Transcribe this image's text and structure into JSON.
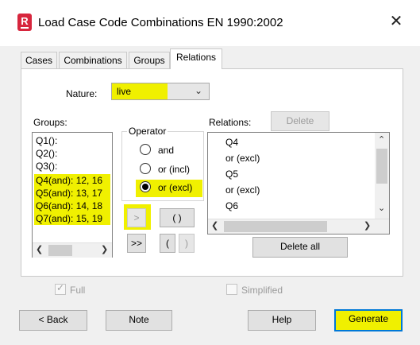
{
  "window": {
    "app_icon_letter": "R",
    "title": "Load Case Code Combinations EN 1990:2002",
    "close_glyph": "✕"
  },
  "tabs": [
    {
      "label": "Cases",
      "active": false
    },
    {
      "label": "Combinations",
      "active": false
    },
    {
      "label": "Groups",
      "active": false
    },
    {
      "label": "Relations",
      "active": true
    }
  ],
  "nature": {
    "label": "Nature:",
    "value": "live"
  },
  "groups": {
    "label": "Groups:",
    "items": [
      "Q1():",
      "Q2():",
      "Q3():",
      "Q4(and): 12, 16",
      "Q5(and): 13, 17",
      "Q6(and): 14, 18",
      "Q7(and): 15, 19"
    ]
  },
  "operator": {
    "label": "Operator",
    "options": [
      {
        "label": "and",
        "selected": false
      },
      {
        "label": "or (incl)",
        "selected": false
      },
      {
        "label": "or (excl)",
        "selected": true
      }
    ]
  },
  "buttons": {
    "add": ">",
    "add_all": ">>",
    "parens": "( )",
    "open_paren": "(",
    "close_paren": ")",
    "delete": "Delete",
    "delete_all": "Delete all",
    "back": "< Back",
    "note": "Note",
    "help": "Help",
    "generate": "Generate"
  },
  "relations": {
    "label": "Relations:",
    "items": [
      "Q4",
      "or (excl)",
      "Q5",
      "or (excl)",
      "Q6"
    ]
  },
  "checks": {
    "full": {
      "label": "Full",
      "checked": true
    },
    "simplified": {
      "label": "Simplified",
      "checked": false
    }
  },
  "colors": {
    "highlight": "#f0f000",
    "accent": "#0078d7"
  }
}
